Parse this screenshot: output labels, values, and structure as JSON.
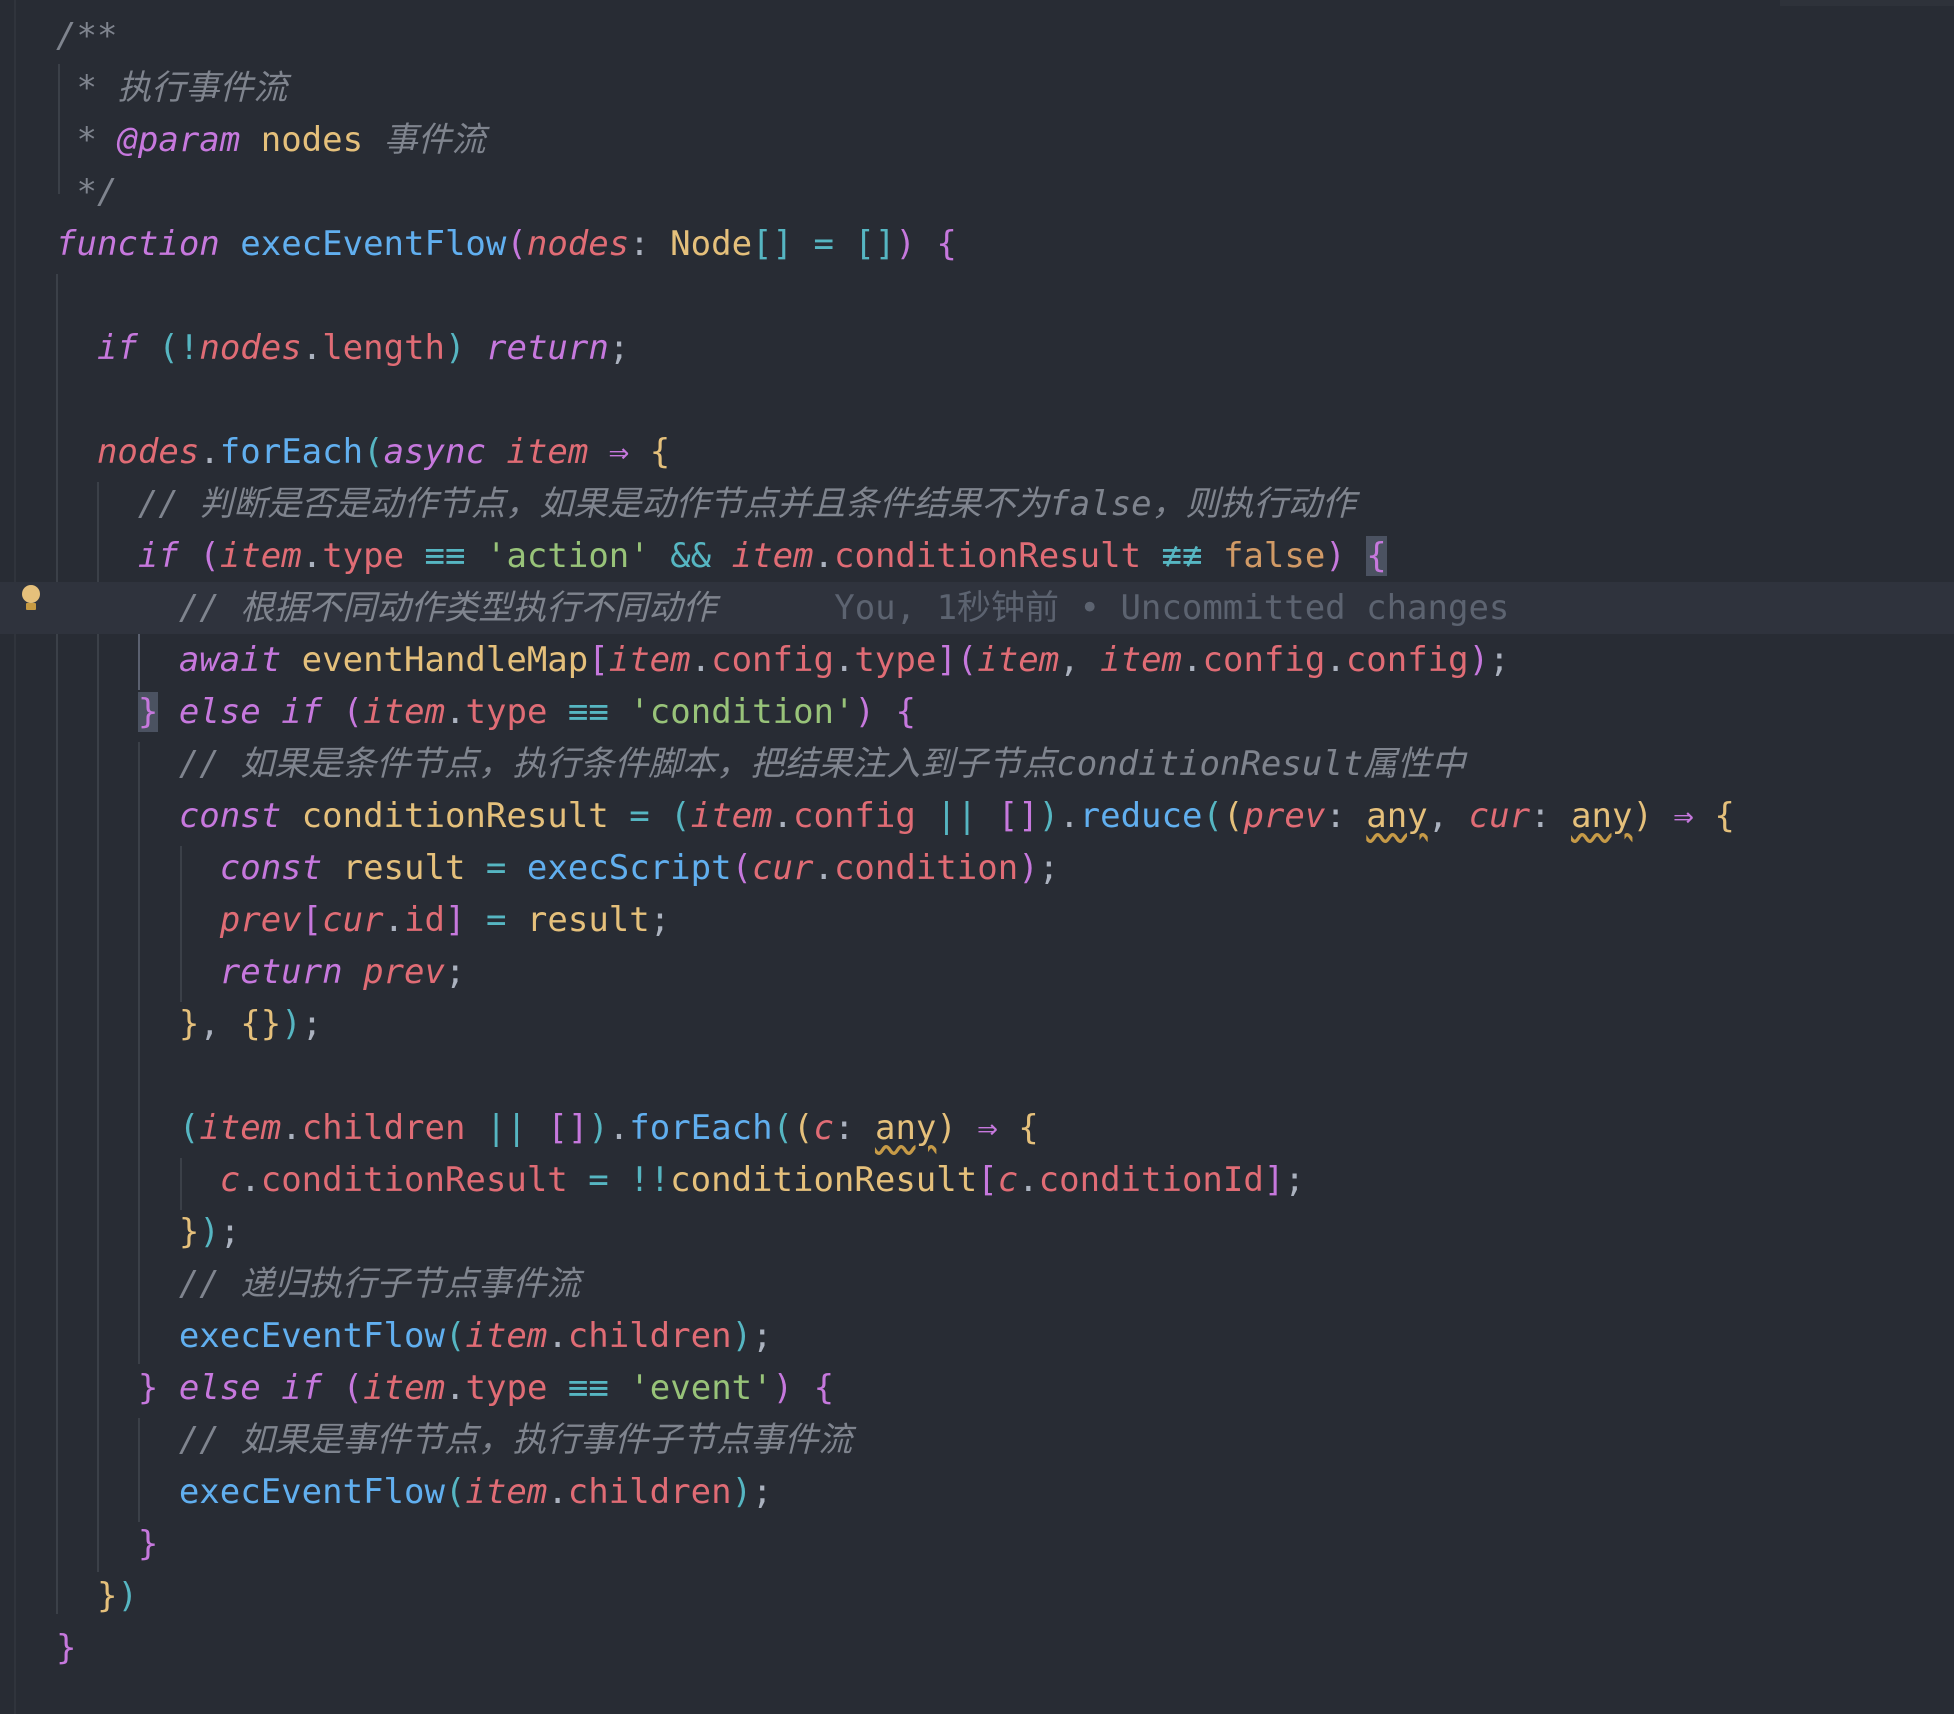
{
  "editor": {
    "language": "typescript",
    "current_line": 12,
    "blame_annotation": "You, 1秒钟前 • Uncommitted changes"
  },
  "lines": [
    {
      "tokens": [
        {
          "t": "/**",
          "c": "c-comment"
        }
      ]
    },
    {
      "tokens": [
        {
          "t": " * 执行事件流",
          "c": "c-comment"
        }
      ]
    },
    {
      "tokens": [
        {
          "t": " * ",
          "c": "c-comment"
        },
        {
          "t": "@param",
          "c": "c-kw"
        },
        {
          "t": " ",
          "c": "c-comment"
        },
        {
          "t": "nodes",
          "c": "c-type"
        },
        {
          "t": " 事件流",
          "c": "c-comment"
        }
      ]
    },
    {
      "tokens": [
        {
          "t": " */",
          "c": "c-comment"
        }
      ]
    },
    {
      "tokens": [
        {
          "t": "function",
          "c": "c-kw"
        },
        {
          "t": " ",
          "c": "c-punc"
        },
        {
          "t": "execEventFlow",
          "c": "c-fn"
        },
        {
          "t": "(",
          "c": "b2"
        },
        {
          "t": "nodes",
          "c": "c-param"
        },
        {
          "t": ": ",
          "c": "c-punc"
        },
        {
          "t": "Node",
          "c": "c-type"
        },
        {
          "t": "[]",
          "c": "b3"
        },
        {
          "t": " = ",
          "c": "c-op"
        },
        {
          "t": "[]",
          "c": "b3"
        },
        {
          "t": ") ",
          "c": "b2"
        },
        {
          "t": "{",
          "c": "b2"
        }
      ]
    },
    {
      "tokens": []
    },
    {
      "tokens": [
        {
          "t": "  ",
          "c": "c-punc"
        },
        {
          "t": "if",
          "c": "c-kw"
        },
        {
          "t": " ",
          "c": "c-punc"
        },
        {
          "t": "(",
          "c": "b3"
        },
        {
          "t": "!",
          "c": "c-op"
        },
        {
          "t": "nodes",
          "c": "c-param"
        },
        {
          "t": ".",
          "c": "c-punc"
        },
        {
          "t": "length",
          "c": "c-prop"
        },
        {
          "t": ")",
          "c": "b3"
        },
        {
          "t": " ",
          "c": "c-punc"
        },
        {
          "t": "return",
          "c": "c-kw"
        },
        {
          "t": ";",
          "c": "c-punc"
        }
      ]
    },
    {
      "tokens": []
    },
    {
      "tokens": [
        {
          "t": "  ",
          "c": "c-punc"
        },
        {
          "t": "nodes",
          "c": "c-param"
        },
        {
          "t": ".",
          "c": "c-punc"
        },
        {
          "t": "forEach",
          "c": "c-fn"
        },
        {
          "t": "(",
          "c": "b3"
        },
        {
          "t": "async",
          "c": "c-kw"
        },
        {
          "t": " ",
          "c": "c-punc"
        },
        {
          "t": "item",
          "c": "c-param"
        },
        {
          "t": " ⇒ ",
          "c": "c-kw"
        },
        {
          "t": "{",
          "c": "b1"
        }
      ]
    },
    {
      "tokens": [
        {
          "t": "    // 判断是否是动作节点，如果是动作节点并且条件结果不为false，则执行动作",
          "c": "c-comment"
        }
      ]
    },
    {
      "tokens": [
        {
          "t": "    ",
          "c": "c-punc"
        },
        {
          "t": "if",
          "c": "c-kw"
        },
        {
          "t": " ",
          "c": "c-punc"
        },
        {
          "t": "(",
          "c": "b2"
        },
        {
          "t": "item",
          "c": "c-param"
        },
        {
          "t": ".",
          "c": "c-punc"
        },
        {
          "t": "type",
          "c": "c-prop"
        },
        {
          "t": " ≡≡ ",
          "c": "c-op"
        },
        {
          "t": "'action'",
          "c": "c-str"
        },
        {
          "t": " && ",
          "c": "c-op"
        },
        {
          "t": "item",
          "c": "c-param"
        },
        {
          "t": ".",
          "c": "c-punc"
        },
        {
          "t": "conditionResult",
          "c": "c-prop"
        },
        {
          "t": " ≢≢ ",
          "c": "c-op"
        },
        {
          "t": "false",
          "c": "c-bool"
        },
        {
          "t": ")",
          "c": "b2"
        },
        {
          "t": " ",
          "c": "c-punc"
        },
        {
          "t": "{",
          "c": "b2 bmatch"
        }
      ]
    },
    {
      "tokens": [
        {
          "t": "      // 根据不同动作类型执行不同动作",
          "c": "c-comment"
        }
      ],
      "blame": true
    },
    {
      "tokens": [
        {
          "t": "      ",
          "c": "c-punc"
        },
        {
          "t": "await",
          "c": "c-kw"
        },
        {
          "t": " ",
          "c": "c-punc"
        },
        {
          "t": "eventHandleMap",
          "c": "c-var"
        },
        {
          "t": "[",
          "c": "b2"
        },
        {
          "t": "item",
          "c": "c-param"
        },
        {
          "t": ".",
          "c": "c-punc"
        },
        {
          "t": "config",
          "c": "c-prop"
        },
        {
          "t": ".",
          "c": "c-punc"
        },
        {
          "t": "type",
          "c": "c-prop"
        },
        {
          "t": "]",
          "c": "b2"
        },
        {
          "t": "(",
          "c": "b2"
        },
        {
          "t": "item",
          "c": "c-param"
        },
        {
          "t": ", ",
          "c": "c-punc"
        },
        {
          "t": "item",
          "c": "c-param"
        },
        {
          "t": ".",
          "c": "c-punc"
        },
        {
          "t": "config",
          "c": "c-prop"
        },
        {
          "t": ".",
          "c": "c-punc"
        },
        {
          "t": "config",
          "c": "c-prop"
        },
        {
          "t": ")",
          "c": "b2"
        },
        {
          "t": ";",
          "c": "c-punc"
        }
      ]
    },
    {
      "tokens": [
        {
          "t": "    ",
          "c": "c-punc"
        },
        {
          "t": "}",
          "c": "b2 bmatch"
        },
        {
          "t": " ",
          "c": "c-punc"
        },
        {
          "t": "else",
          "c": "c-kw"
        },
        {
          "t": " ",
          "c": "c-punc"
        },
        {
          "t": "if",
          "c": "c-kw"
        },
        {
          "t": " ",
          "c": "c-punc"
        },
        {
          "t": "(",
          "c": "b2"
        },
        {
          "t": "item",
          "c": "c-param"
        },
        {
          "t": ".",
          "c": "c-punc"
        },
        {
          "t": "type",
          "c": "c-prop"
        },
        {
          "t": " ≡≡ ",
          "c": "c-op"
        },
        {
          "t": "'condition'",
          "c": "c-str"
        },
        {
          "t": ")",
          "c": "b2"
        },
        {
          "t": " ",
          "c": "c-punc"
        },
        {
          "t": "{",
          "c": "b2"
        }
      ]
    },
    {
      "tokens": [
        {
          "t": "      // 如果是条件节点，执行条件脚本，把结果注入到子节点conditionResult属性中",
          "c": "c-comment"
        }
      ]
    },
    {
      "tokens": [
        {
          "t": "      ",
          "c": "c-punc"
        },
        {
          "t": "const",
          "c": "c-kw"
        },
        {
          "t": " ",
          "c": "c-punc"
        },
        {
          "t": "conditionResult",
          "c": "c-var"
        },
        {
          "t": " = ",
          "c": "c-op"
        },
        {
          "t": "(",
          "c": "b3"
        },
        {
          "t": "item",
          "c": "c-param"
        },
        {
          "t": ".",
          "c": "c-punc"
        },
        {
          "t": "config",
          "c": "c-prop"
        },
        {
          "t": " || ",
          "c": "c-op"
        },
        {
          "t": "[]",
          "c": "b2"
        },
        {
          "t": ")",
          "c": "b3"
        },
        {
          "t": ".",
          "c": "c-punc"
        },
        {
          "t": "reduce",
          "c": "c-fn"
        },
        {
          "t": "(",
          "c": "b3"
        },
        {
          "t": "(",
          "c": "b1"
        },
        {
          "t": "prev",
          "c": "c-param"
        },
        {
          "t": ": ",
          "c": "c-punc"
        },
        {
          "t": "any",
          "c": "c-type wavy"
        },
        {
          "t": ", ",
          "c": "c-punc"
        },
        {
          "t": "cur",
          "c": "c-param"
        },
        {
          "t": ": ",
          "c": "c-punc"
        },
        {
          "t": "any",
          "c": "c-type wavy"
        },
        {
          "t": ")",
          "c": "b1"
        },
        {
          "t": " ⇒ ",
          "c": "c-kw"
        },
        {
          "t": "{",
          "c": "b1"
        }
      ]
    },
    {
      "tokens": [
        {
          "t": "        ",
          "c": "c-punc"
        },
        {
          "t": "const",
          "c": "c-kw"
        },
        {
          "t": " ",
          "c": "c-punc"
        },
        {
          "t": "result",
          "c": "c-var"
        },
        {
          "t": " = ",
          "c": "c-op"
        },
        {
          "t": "execScript",
          "c": "c-fn"
        },
        {
          "t": "(",
          "c": "b2"
        },
        {
          "t": "cur",
          "c": "c-param"
        },
        {
          "t": ".",
          "c": "c-punc"
        },
        {
          "t": "condition",
          "c": "c-prop"
        },
        {
          "t": ")",
          "c": "b2"
        },
        {
          "t": ";",
          "c": "c-punc"
        }
      ]
    },
    {
      "tokens": [
        {
          "t": "        ",
          "c": "c-punc"
        },
        {
          "t": "prev",
          "c": "c-param"
        },
        {
          "t": "[",
          "c": "b2"
        },
        {
          "t": "cur",
          "c": "c-param"
        },
        {
          "t": ".",
          "c": "c-punc"
        },
        {
          "t": "id",
          "c": "c-prop"
        },
        {
          "t": "]",
          "c": "b2"
        },
        {
          "t": " = ",
          "c": "c-op"
        },
        {
          "t": "result",
          "c": "c-var"
        },
        {
          "t": ";",
          "c": "c-punc"
        }
      ]
    },
    {
      "tokens": [
        {
          "t": "        ",
          "c": "c-punc"
        },
        {
          "t": "return",
          "c": "c-kw"
        },
        {
          "t": " ",
          "c": "c-punc"
        },
        {
          "t": "prev",
          "c": "c-param"
        },
        {
          "t": ";",
          "c": "c-punc"
        }
      ]
    },
    {
      "tokens": [
        {
          "t": "      ",
          "c": "c-punc"
        },
        {
          "t": "}",
          "c": "b1"
        },
        {
          "t": ", ",
          "c": "c-punc"
        },
        {
          "t": "{}",
          "c": "b1"
        },
        {
          "t": ")",
          "c": "b3"
        },
        {
          "t": ";",
          "c": "c-punc"
        }
      ]
    },
    {
      "tokens": []
    },
    {
      "tokens": [
        {
          "t": "      ",
          "c": "c-punc"
        },
        {
          "t": "(",
          "c": "b3"
        },
        {
          "t": "item",
          "c": "c-param"
        },
        {
          "t": ".",
          "c": "c-punc"
        },
        {
          "t": "children",
          "c": "c-prop"
        },
        {
          "t": " || ",
          "c": "c-op"
        },
        {
          "t": "[]",
          "c": "b2"
        },
        {
          "t": ")",
          "c": "b3"
        },
        {
          "t": ".",
          "c": "c-punc"
        },
        {
          "t": "forEach",
          "c": "c-fn"
        },
        {
          "t": "(",
          "c": "b3"
        },
        {
          "t": "(",
          "c": "b1"
        },
        {
          "t": "c",
          "c": "c-param"
        },
        {
          "t": ": ",
          "c": "c-punc"
        },
        {
          "t": "any",
          "c": "c-type wavy"
        },
        {
          "t": ")",
          "c": "b1"
        },
        {
          "t": " ⇒ ",
          "c": "c-kw"
        },
        {
          "t": "{",
          "c": "b1"
        }
      ]
    },
    {
      "tokens": [
        {
          "t": "        ",
          "c": "c-punc"
        },
        {
          "t": "c",
          "c": "c-param"
        },
        {
          "t": ".",
          "c": "c-punc"
        },
        {
          "t": "conditionResult",
          "c": "c-prop"
        },
        {
          "t": " = ",
          "c": "c-op"
        },
        {
          "t": "!!",
          "c": "c-op"
        },
        {
          "t": "conditionResult",
          "c": "c-var"
        },
        {
          "t": "[",
          "c": "b2"
        },
        {
          "t": "c",
          "c": "c-param"
        },
        {
          "t": ".",
          "c": "c-punc"
        },
        {
          "t": "conditionId",
          "c": "c-prop"
        },
        {
          "t": "]",
          "c": "b2"
        },
        {
          "t": ";",
          "c": "c-punc"
        }
      ]
    },
    {
      "tokens": [
        {
          "t": "      ",
          "c": "c-punc"
        },
        {
          "t": "}",
          "c": "b1"
        },
        {
          "t": ")",
          "c": "b3"
        },
        {
          "t": ";",
          "c": "c-punc"
        }
      ]
    },
    {
      "tokens": [
        {
          "t": "      // 递归执行子节点事件流",
          "c": "c-comment"
        }
      ]
    },
    {
      "tokens": [
        {
          "t": "      ",
          "c": "c-punc"
        },
        {
          "t": "execEventFlow",
          "c": "c-fn"
        },
        {
          "t": "(",
          "c": "b3"
        },
        {
          "t": "item",
          "c": "c-param"
        },
        {
          "t": ".",
          "c": "c-punc"
        },
        {
          "t": "children",
          "c": "c-prop"
        },
        {
          "t": ")",
          "c": "b3"
        },
        {
          "t": ";",
          "c": "c-punc"
        }
      ]
    },
    {
      "tokens": [
        {
          "t": "    ",
          "c": "c-punc"
        },
        {
          "t": "}",
          "c": "b2"
        },
        {
          "t": " ",
          "c": "c-punc"
        },
        {
          "t": "else",
          "c": "c-kw"
        },
        {
          "t": " ",
          "c": "c-punc"
        },
        {
          "t": "if",
          "c": "c-kw"
        },
        {
          "t": " ",
          "c": "c-punc"
        },
        {
          "t": "(",
          "c": "b2"
        },
        {
          "t": "item",
          "c": "c-param"
        },
        {
          "t": ".",
          "c": "c-punc"
        },
        {
          "t": "type",
          "c": "c-prop"
        },
        {
          "t": " ≡≡ ",
          "c": "c-op"
        },
        {
          "t": "'event'",
          "c": "c-str"
        },
        {
          "t": ")",
          "c": "b2"
        },
        {
          "t": " ",
          "c": "c-punc"
        },
        {
          "t": "{",
          "c": "b2"
        }
      ]
    },
    {
      "tokens": [
        {
          "t": "      // 如果是事件节点，执行事件子节点事件流",
          "c": "c-comment"
        }
      ]
    },
    {
      "tokens": [
        {
          "t": "      ",
          "c": "c-punc"
        },
        {
          "t": "execEventFlow",
          "c": "c-fn"
        },
        {
          "t": "(",
          "c": "b3"
        },
        {
          "t": "item",
          "c": "c-param"
        },
        {
          "t": ".",
          "c": "c-punc"
        },
        {
          "t": "children",
          "c": "c-prop"
        },
        {
          "t": ")",
          "c": "b3"
        },
        {
          "t": ";",
          "c": "c-punc"
        }
      ]
    },
    {
      "tokens": [
        {
          "t": "    ",
          "c": "c-punc"
        },
        {
          "t": "}",
          "c": "b2"
        }
      ]
    },
    {
      "tokens": [
        {
          "t": "  ",
          "c": "c-punc"
        },
        {
          "t": "}",
          "c": "b1"
        },
        {
          "t": ")",
          "c": "b3"
        }
      ]
    },
    {
      "tokens": [
        {
          "t": "}",
          "c": "b2"
        }
      ]
    }
  ]
}
